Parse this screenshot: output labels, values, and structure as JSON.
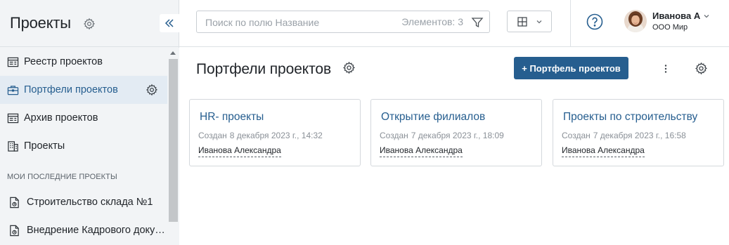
{
  "sidebar": {
    "title": "Проекты",
    "items": [
      {
        "label": "Реестр проектов",
        "icon": "registry-icon"
      },
      {
        "label": "Портфели проектов",
        "icon": "briefcase-icon",
        "active": true
      },
      {
        "label": "Архив проектов",
        "icon": "archive-icon"
      },
      {
        "label": "Проекты",
        "icon": "building-icon"
      }
    ],
    "section_label": "МОИ ПОСЛЕДНИЕ ПРОЕКТЫ",
    "recent": [
      {
        "label": "Строительство склада №1",
        "icon": "project-doc-icon"
      },
      {
        "label": "Внедрение Кадрового доку…",
        "icon": "project-doc-icon"
      }
    ]
  },
  "topbar": {
    "search_placeholder": "Поиск по полю Название",
    "count_text": "Элементов: 3",
    "user": {
      "name": "Иванова А",
      "org": "ООО Мир"
    }
  },
  "main": {
    "title": "Портфели проектов",
    "add_button": "+ Портфель проектов",
    "cards": [
      {
        "title": "HR- проекты",
        "created_label": "Создан",
        "date": "8 декабря 2023 г., 14:32",
        "author": "Иванова Александра"
      },
      {
        "title": "Открытие филиалов",
        "created_label": "Создан",
        "date": "7 декабря 2023 г., 18:09",
        "author": "Иванова Александра"
      },
      {
        "title": "Проекты по строительству",
        "created_label": "Создан",
        "date": "7 декабря 2023 г., 16:58",
        "author": "Иванова Александра"
      }
    ]
  },
  "colors": {
    "accent": "#265e8f",
    "sidebar_bg": "#f2f4f6",
    "active_bg": "#e3ebf3"
  }
}
